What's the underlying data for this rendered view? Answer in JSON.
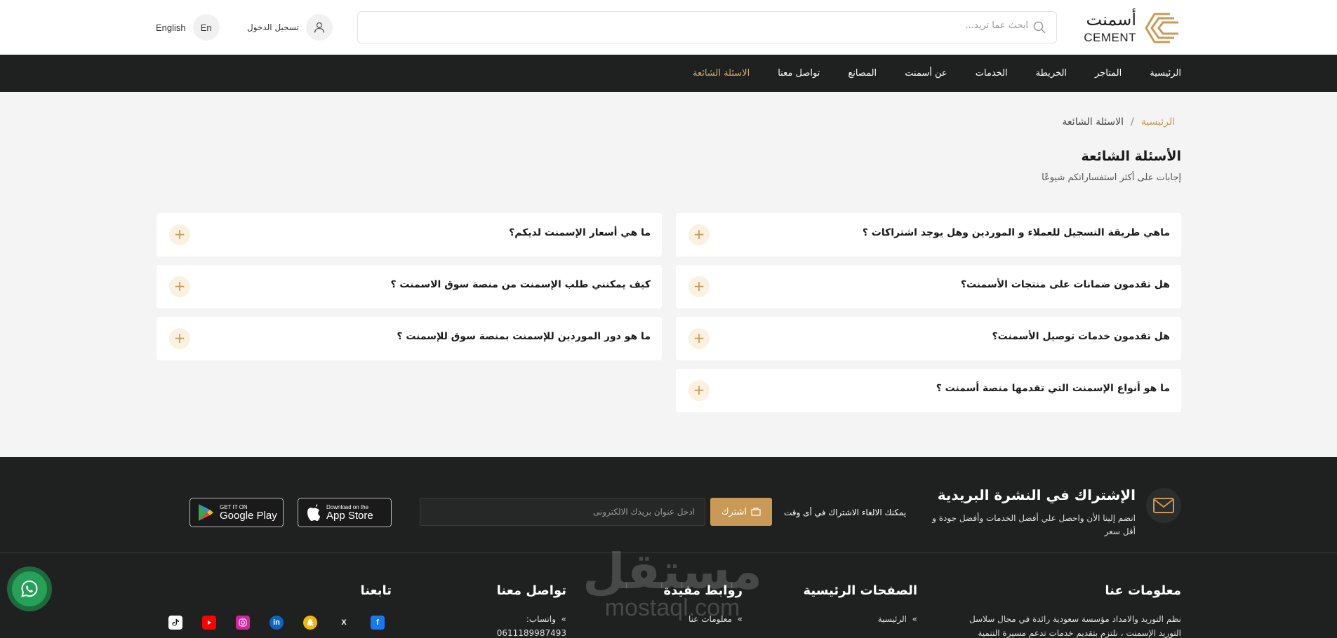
{
  "header": {
    "logo_ar": "أسمنت",
    "logo_en": "CEMENT",
    "search_placeholder": "ابحث عما تريد...",
    "login_label": "تسجيل الدخول",
    "lang_label": "English",
    "lang_badge": "En"
  },
  "nav": {
    "items": [
      "الرئيسية",
      "المتاجر",
      "الخريطة",
      "الخدمات",
      "عن أسمنت",
      "المصانع",
      "تواصل معنا",
      "الاسئلة الشائعة"
    ],
    "active_index": 7
  },
  "breadcrumb": {
    "home": "الرئيسية",
    "separator": "/",
    "current": "الاسئلة الشائعة"
  },
  "page": {
    "title": "الأسئلة الشائعة",
    "subtitle": "إجابات على أكثر استفساراتكم شيوعًا"
  },
  "faq": {
    "right": [
      "ماهي طريقة التسجيل للعملاء و الموردين وهل يوجد اشتراكات ؟",
      "هل تقدمون ضمانات على منتجات الأسمنت؟",
      "هل تقدمون خدمات توصيل الأسمنت؟",
      "ما هو أنواع الإسمنت التي تقدمها منصة أسمنت ؟"
    ],
    "left": [
      "ما هي أسعار الإسمنت لديكم؟",
      "كيف يمكنني طلب الإسمنت من منصة سوق الاسمنت ؟",
      "ما هو دور الموردين للإسمنت بمنصة سوق للإسمنت ؟"
    ],
    "expand_symbol": "+"
  },
  "newsletter": {
    "title": "الإشتراك في النشرة البريدية",
    "subtitle": "انضم إلينا الأن واحصل علي أفضل الخدمات وأفضل جودة و أقل سعر",
    "unsubscribe_note": "يمكنك الالغاء الاشتراك في أى وقت",
    "subscribe_label": "اشترك",
    "email_placeholder": "ادخل عنوان بريدك الالكترونى"
  },
  "stores": {
    "app_store_small": "Download on the",
    "app_store_big": "App Store",
    "google_small": "GET IT ON",
    "google_big": "Google Play"
  },
  "footer": {
    "about_title": "معلومات عنا",
    "about_text_1": "نظم التوريد والامداد مؤسسة سعودية رائدة في مجال سلاسل",
    "about_text_2": "التوريد الإسمنت ، نلتزم بتقديم خدمات تدعم مسيرة التنمية",
    "pages_title": "الصفحات الرئيسية",
    "pages_item_1": "الرئيسية",
    "links_title": "روابط مفيدة",
    "links_item_1": "معلومات عنا",
    "contact_title": "تواصل معنا",
    "contact_item_1": "واتساب:",
    "contact_item_2": "0611189987493",
    "follow_title": "تابعنا"
  },
  "watermark": {
    "ar": "مستقل",
    "en": "mostaql.com"
  },
  "colors": {
    "accent": "#c99a55",
    "dark": "#1f2120",
    "whatsapp": "#25a257"
  }
}
